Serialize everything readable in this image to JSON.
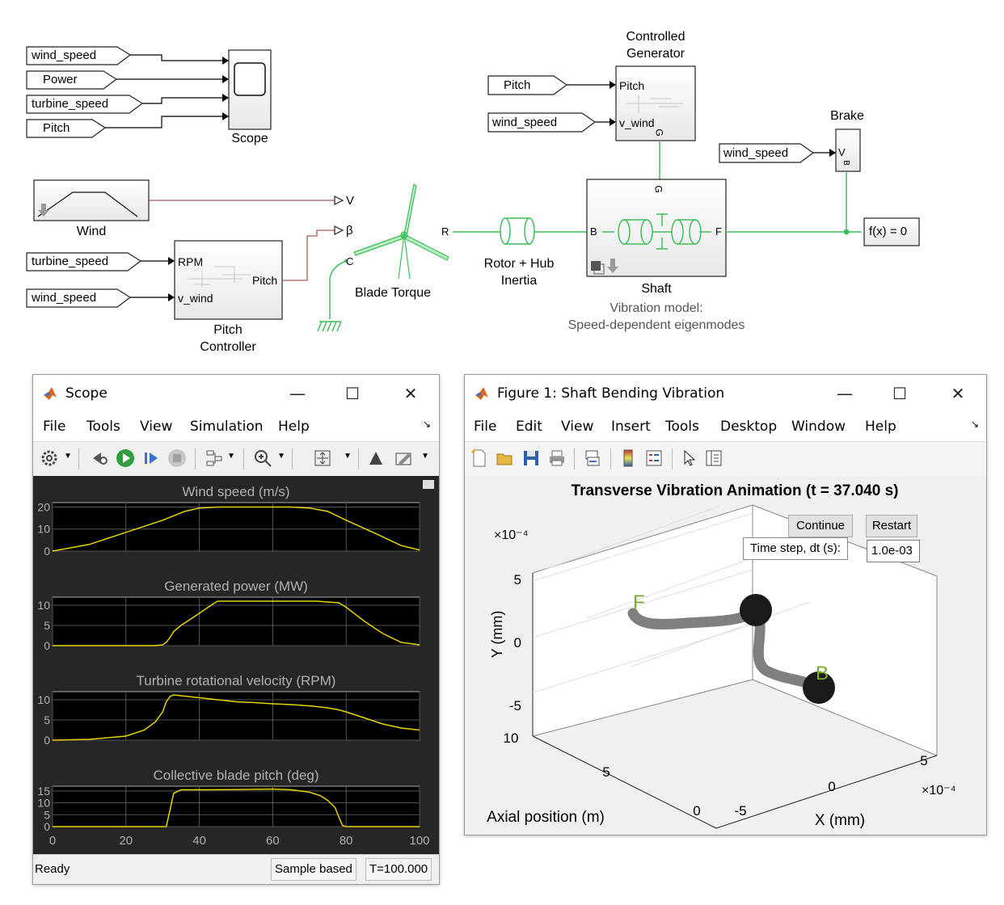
{
  "diagram": {
    "scope_inputs": [
      "wind_speed",
      "Power",
      "turbine_speed",
      "Pitch"
    ],
    "scope_label": "Scope",
    "wind_label": "Wind",
    "pitch_controller_inputs": [
      "turbine_speed",
      "wind_speed"
    ],
    "pitch_controller_ports": {
      "rpm": "RPM",
      "v_wind": "v_wind",
      "pitch": "Pitch"
    },
    "pitch_controller_label": [
      "Pitch",
      "Controller"
    ],
    "port_v": "V",
    "port_beta": "β",
    "port_c": "C",
    "port_r": "R",
    "blade_torque_label": "Blade Torque",
    "rotor_label": [
      "Rotor + Hub",
      "Inertia"
    ],
    "generator_label": [
      "Controlled",
      "Generator"
    ],
    "generator_inputs": [
      "Pitch",
      "wind_speed"
    ],
    "generator_ports": {
      "pitch": "Pitch",
      "v_wind": "v_wind",
      "g": "G"
    },
    "shaft_ports": {
      "g": "G",
      "b": "B",
      "f": "F"
    },
    "shaft_label": "Shaft",
    "shaft_sub": [
      "Vibration model:",
      "Speed-dependent eigenmodes"
    ],
    "brake_label": "Brake",
    "brake_input": "wind_speed",
    "brake_ports": {
      "v": "V",
      "b": "B"
    },
    "solver": "f(x) = 0"
  },
  "scope_window": {
    "title": "Scope",
    "menu": [
      "File",
      "Tools",
      "View",
      "Simulation",
      "Help"
    ],
    "status": {
      "left": "Ready",
      "mode": "Sample based",
      "time": "T=100.000"
    },
    "x_ticks": [
      "0",
      "20",
      "40",
      "60",
      "80",
      "100"
    ],
    "trace_color": "#e6d400",
    "plot_bg": "#000000",
    "panel_bg": "#262626"
  },
  "figure_window": {
    "title": "Figure 1: Shaft Bending Vibration",
    "menu": [
      "File",
      "Edit",
      "View",
      "Insert",
      "Tools",
      "Desktop",
      "Window",
      "Help"
    ],
    "continue_label": "Continue",
    "restart_label": "Restart",
    "dt_label": "Time step, dt (s):",
    "dt_value": "1.0e-03"
  },
  "chart_data": [
    {
      "type": "line",
      "title": "Wind speed (m/s)",
      "x": [
        0,
        10,
        20,
        30,
        36,
        40,
        45,
        50,
        55,
        60,
        65,
        70,
        75,
        80,
        88,
        95,
        100
      ],
      "series": [
        {
          "values": [
            0,
            3,
            8.5,
            14,
            18,
            19.5,
            20,
            20,
            20,
            20,
            20,
            19.5,
            18,
            14,
            8,
            2.5,
            0.5
          ]
        }
      ],
      "ylim": [
        0,
        22
      ],
      "yticks": [
        "0",
        "10",
        "20"
      ],
      "xlim": [
        0,
        100
      ]
    },
    {
      "type": "line",
      "title": "Generated power (MW)",
      "x": [
        0,
        28,
        30,
        31,
        32,
        33,
        35,
        40,
        44,
        45,
        50,
        55,
        60,
        65,
        70,
        72,
        75,
        78,
        80,
        85,
        90,
        95,
        100
      ],
      "series": [
        {
          "values": [
            0,
            0,
            0.2,
            0.8,
            2,
            3.5,
            5,
            8,
            10.5,
            11,
            11,
            11,
            11,
            11,
            11,
            11,
            10.8,
            10.6,
            9.5,
            6,
            3,
            0.8,
            0.2
          ]
        }
      ],
      "ylim": [
        0,
        12
      ],
      "yticks": [
        "0",
        "5",
        "10"
      ],
      "xlim": [
        0,
        100
      ]
    },
    {
      "type": "line",
      "title": "Turbine rotational velocity (RPM)",
      "x": [
        0,
        10,
        20,
        25,
        28,
        30,
        31,
        32,
        33,
        35,
        40,
        45,
        50,
        55,
        60,
        65,
        70,
        75,
        78,
        80,
        85,
        90,
        95,
        100
      ],
      "series": [
        {
          "values": [
            0,
            0.2,
            1,
            2.5,
            4.5,
            7,
            9.5,
            10.8,
            11.2,
            11,
            10.5,
            10,
            9.5,
            9.3,
            9,
            8.8,
            8.5,
            8,
            7.5,
            7,
            5.5,
            4,
            3,
            2.5
          ]
        }
      ],
      "ylim": [
        0,
        12
      ],
      "yticks": [
        "0",
        "5",
        "10"
      ],
      "xlim": [
        0,
        100
      ]
    },
    {
      "type": "line",
      "title": "Collective blade pitch (deg)",
      "x": [
        0,
        31,
        32,
        33,
        35,
        40,
        50,
        60,
        65,
        70,
        73,
        75,
        77,
        78,
        79,
        80,
        100
      ],
      "series": [
        {
          "values": [
            0,
            0,
            7,
            14,
            15.5,
            15.5,
            15.6,
            15.8,
            15.5,
            14.5,
            13,
            11,
            8,
            4,
            0.5,
            0,
            0
          ]
        }
      ],
      "ylim": [
        0,
        17
      ],
      "yticks": [
        "0",
        "5",
        "10",
        "15"
      ],
      "xlim": [
        0,
        100
      ]
    },
    {
      "type": "line",
      "title": "Transverse Vibration Animation (t = 37.040 s)",
      "xlabel": "X (mm)",
      "ylabel": "Y (mm)",
      "zlabel": "Axial position (m)",
      "axis_multiplier": "×10⁻⁴",
      "yticks": [
        "5",
        "0",
        "-5"
      ],
      "xticks": [
        "-5",
        "0",
        "5"
      ],
      "zticks": [
        "0",
        "5",
        "10"
      ],
      "endpoints": [
        "F",
        "B"
      ],
      "curve_color": "#7f7f7f",
      "endpoint_label_color": "#77ac30"
    }
  ]
}
